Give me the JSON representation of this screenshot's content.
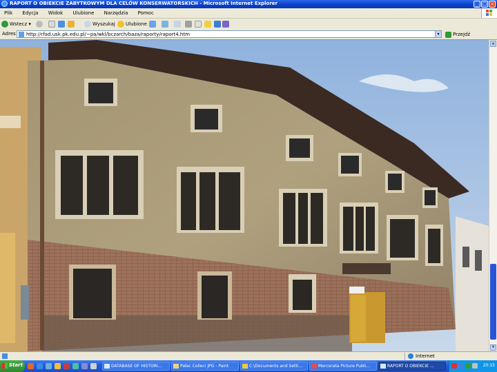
{
  "window": {
    "title": "RAPORT O OBIEKCIE ZABYTKOWYM DLA CELÓW KONSERWATORSKICH - Microsoft Internet Explorer",
    "min_label": "_",
    "max_label": "□",
    "close_label": "×"
  },
  "menu": {
    "items": [
      "Plik",
      "Edycja",
      "Widok",
      "Ulubione",
      "Narzędzia",
      "Pomoc"
    ]
  },
  "toolbar": {
    "back_label": "Wstecz",
    "search_label": "Wyszukaj",
    "favorites_label": "Ulubione"
  },
  "address": {
    "label": "Adres",
    "url": "http://rfad.usk.pk.edu.pl/~pa/wkl/bczarch/baza/raporty/raport4.htm",
    "go_label": "Przejdź"
  },
  "content": {
    "image_subject": "historic-townhouse-photo"
  },
  "status": {
    "zone_label": "Internet"
  },
  "taskbar": {
    "start_label": "Start",
    "tasks": [
      "DATABASE OF HISTORI...",
      "Pałac Colieci JPG - Paint",
      "C:\\Documents and Setti...",
      "Mercorata Picture Publi...",
      "RAPORT O OBIEKCIE ..."
    ],
    "clock": "20:15"
  },
  "colors": {
    "titlebar": "#0a3fc8",
    "taskbar": "#245ddb",
    "start": "#2e8b2e",
    "sky": "#9cb8dc"
  }
}
